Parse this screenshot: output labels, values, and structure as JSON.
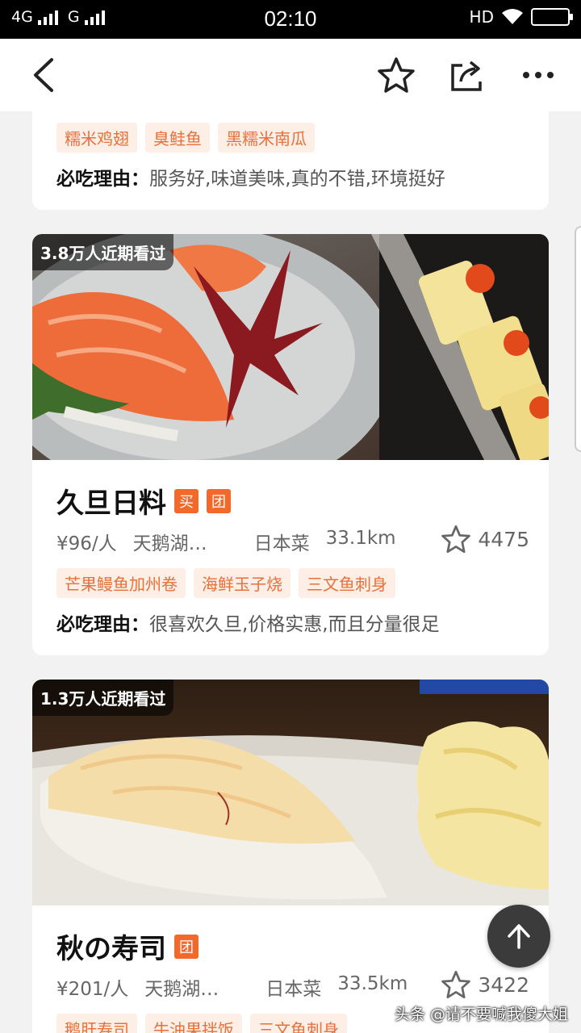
{
  "status_bar": {
    "network1": "4G",
    "network2": "G",
    "time": "02:10",
    "hd": "HD"
  },
  "nav": {
    "back_icon": "chevron-left-icon",
    "star_icon": "star-outline-icon",
    "share_icon": "share-icon",
    "more_icon": "more-horizontal-icon"
  },
  "card_top": {
    "tags": [
      "糯米鸡翅",
      "臭鲑鱼",
      "黑糯米南瓜"
    ],
    "reason_label": "必吃理由：",
    "reason_text": "服务好,味道美味,真的不错,环境挺好"
  },
  "card_1": {
    "views": "3.8万人近期看过",
    "name": "久旦日料",
    "badge_buy": "买",
    "badge_group": "团",
    "price": "¥96/人",
    "area": "天鹅湖…",
    "cuisine": "日本菜",
    "distance": "33.1km",
    "favorites": "4475",
    "tags": [
      "芒果鳗鱼加州卷",
      "海鲜玉子烧",
      "三文鱼刺身"
    ],
    "reason_label": "必吃理由：",
    "reason_text": "很喜欢久旦,价格实惠,而且分量很足"
  },
  "card_2": {
    "views": "1.3万人近期看过",
    "name": "秋の寿司",
    "badge_group": "团",
    "price": "¥201/人",
    "area": "天鹅湖…",
    "cuisine": "日本菜",
    "distance": "33.5km",
    "favorites": "3422",
    "tags": [
      "鹅肝寿司",
      "牛油果拌饭",
      "三文鱼刺身"
    ]
  },
  "watermark": "头条 @请不要喊我傻大姐",
  "colors": {
    "accent": "#f2692a",
    "tag_bg": "#fdeee6",
    "tag_text": "#e8703a"
  }
}
